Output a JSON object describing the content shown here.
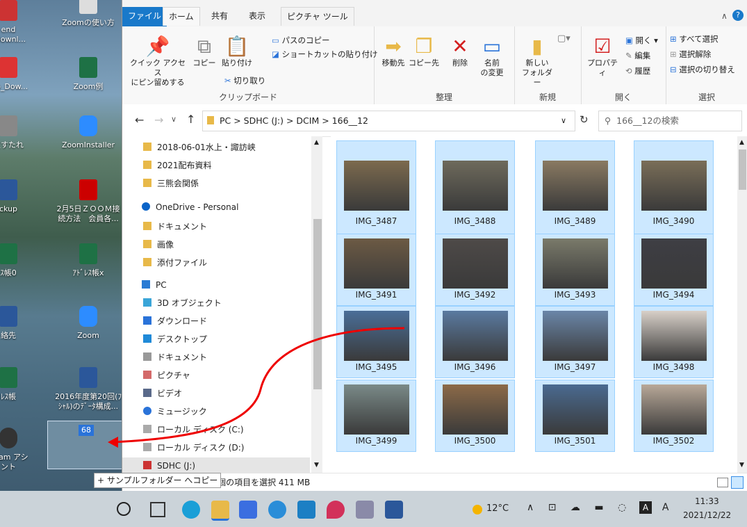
{
  "desktop": {
    "icons": [
      {
        "label": "end",
        "label2": "_Downl..."
      },
      {
        "label": "Zoomの使い方"
      },
      {
        "label": "cro_Dow..."
      },
      {
        "label": "Zoom例"
      },
      {
        "label": "主すたれ"
      },
      {
        "label": "ZoomInstaller"
      },
      {
        "label": "ckup"
      },
      {
        "label": "2月5日ＺＯＯＭ接",
        "label2": "続方法　会員各..."
      },
      {
        "label": "ｽ帳0"
      },
      {
        "label": "ｱﾄﾞﾚｽ帳x"
      },
      {
        "label": "絡先"
      },
      {
        "label": "Zoom"
      },
      {
        "label": "ﾚｽ帳"
      },
      {
        "label": "2016年度第20回(ﾌ",
        "label2": "ｼｬﾙ)のﾃﾞｰﾀ構成..."
      },
      {
        "label": "bCam アシ",
        "label2": "ント"
      }
    ],
    "drag_badge": "68",
    "drag_tip": "+ サンプルフォルダー へコピー"
  },
  "ribbon": {
    "tabs": [
      "ファイル",
      "ホーム",
      "共有",
      "表示",
      "ピクチャ ツール"
    ],
    "clipboard": {
      "pin": "クイック アクセス\nにピン留めする",
      "copy": "コピー",
      "paste": "貼り付け",
      "copy_path": "パスのコピー",
      "paste_shortcut": "ショートカットの貼り付け",
      "cut": "切り取り",
      "label": "クリップボード"
    },
    "organize": {
      "move": "移動先",
      "copyto": "コピー先",
      "delete": "削除",
      "rename": "名前\nの変更",
      "label": "整理"
    },
    "new": {
      "folder": "新しい\nフォルダー",
      "label": "新規"
    },
    "open": {
      "props": "プロパティ",
      "open": "開く",
      "edit": "編集",
      "history": "履歴",
      "label": "開く"
    },
    "select": {
      "all": "すべて選択",
      "none": "選択解除",
      "invert": "選択の切り替え",
      "label": "選択"
    }
  },
  "address": {
    "path": "PC  >  SDHC (J:)  >  DCIM  >  166__12",
    "search_placeholder": "166__12の検索"
  },
  "nav": [
    "2018-06-01水上・諏訪峡",
    "2021配布資料",
    "三熊会関係",
    "OneDrive - Personal",
    "ドキュメント",
    "画像",
    "添付ファイル",
    "PC",
    "3D オブジェクト",
    "ダウンロード",
    "デスクトップ",
    "ドキュメント",
    "ピクチャ",
    "ビデオ",
    "ミュージック",
    "ローカル ディスク (C:)",
    "ローカル ディスク (D:)",
    "SDHC (J:)"
  ],
  "files": [
    "IMG_3487",
    "IMG_3488",
    "IMG_3489",
    "IMG_3490",
    "IMG_3491",
    "IMG_3492",
    "IMG_3493",
    "IMG_3494",
    "IMG_3495",
    "IMG_3496",
    "IMG_3497",
    "IMG_3498",
    "IMG_3499",
    "IMG_3500",
    "IMG_3501",
    "IMG_3502"
  ],
  "status": "68 個の項目を選択  411 MB",
  "taskbar": {
    "temp": "12°C",
    "time": "11:33",
    "date": "2021/12/22"
  }
}
